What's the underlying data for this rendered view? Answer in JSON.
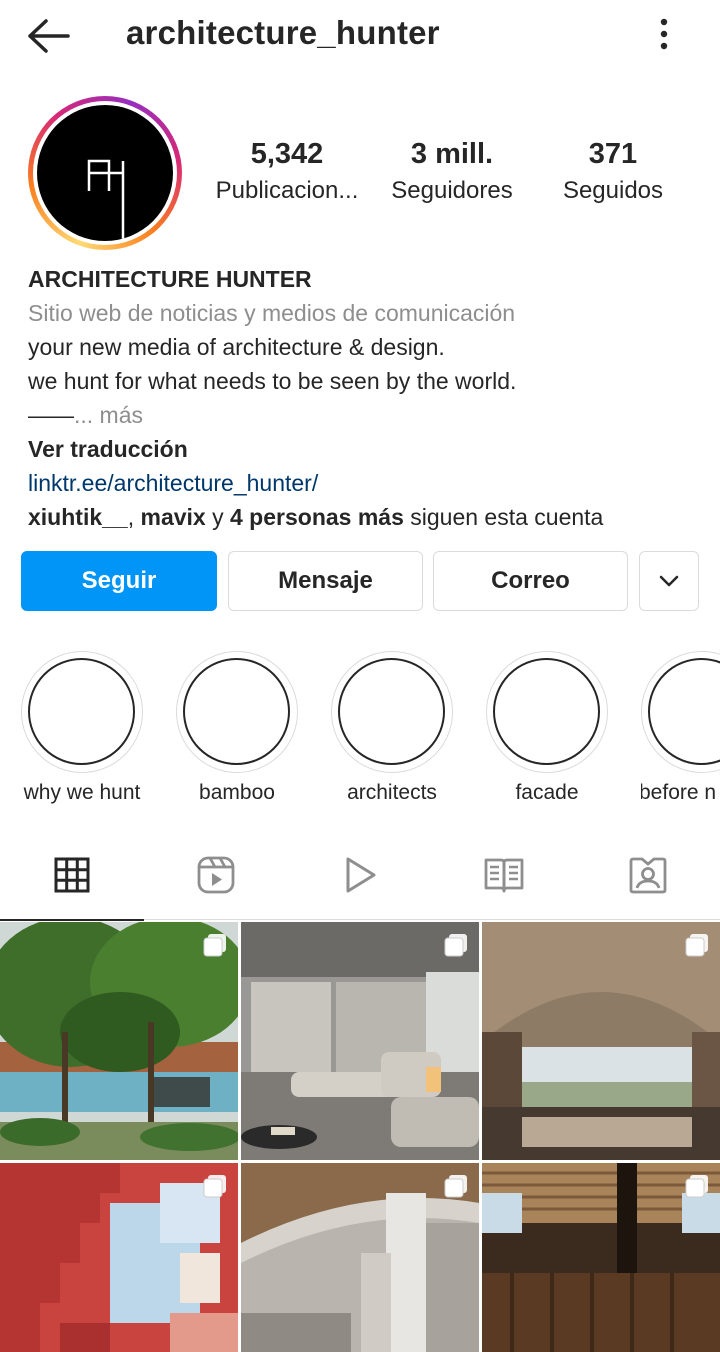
{
  "header": {
    "username": "architecture_hunter",
    "back_icon": "arrow-left-icon",
    "more_icon": "kebab-menu-icon"
  },
  "avatar": {
    "logo_text": "AH",
    "ring_colors": [
      "#feda75",
      "#fa7e1e",
      "#d62976",
      "#962fbf"
    ]
  },
  "stats": {
    "posts": {
      "value": "5,342",
      "label": "Publicacion..."
    },
    "followers": {
      "value": "3 mill.",
      "label": "Seguidores"
    },
    "following": {
      "value": "371",
      "label": "Seguidos"
    }
  },
  "bio": {
    "name": "ARCHITECTURE HUNTER",
    "category": "Sitio web de noticias y medios de comunicación",
    "line1": "your new media of architecture & design.",
    "line2": "we hunt for what needs to be seen by the world.",
    "dashes": "——",
    "more": "... más",
    "translate": "Ver traducción",
    "link": "linktr.ee/architecture_hunter/",
    "followed_by": {
      "user1": "xiuhtik__",
      "sep": ", ",
      "user2": "mavix",
      "and": " y ",
      "others": "4 personas más",
      "suffix": " siguen esta cuenta"
    }
  },
  "actions": {
    "follow": "Seguir",
    "message": "Mensaje",
    "email": "Correo",
    "dropdown_icon": "chevron-down-icon",
    "follow_color": "#0095f6"
  },
  "highlights": [
    {
      "label": "why we hunt"
    },
    {
      "label": "bamboo"
    },
    {
      "label": "architects"
    },
    {
      "label": "facade"
    },
    {
      "label": "before n"
    }
  ],
  "tabs": [
    {
      "icon": "grid-icon",
      "active": true
    },
    {
      "icon": "reels-icon",
      "active": false
    },
    {
      "icon": "play-icon",
      "active": false
    },
    {
      "icon": "guide-book-icon",
      "active": false
    },
    {
      "icon": "tagged-person-icon",
      "active": false
    }
  ],
  "grid_posts": [
    {
      "subject": "garden-trees-building",
      "multi": true
    },
    {
      "subject": "grey-living-room",
      "multi": true
    },
    {
      "subject": "vaulted-bedroom-view",
      "multi": true
    },
    {
      "subject": "red-stair-facade",
      "multi": true
    },
    {
      "subject": "curved-concrete-atrium",
      "multi": true
    },
    {
      "subject": "wood-slat-ceiling-room",
      "multi": true
    }
  ]
}
